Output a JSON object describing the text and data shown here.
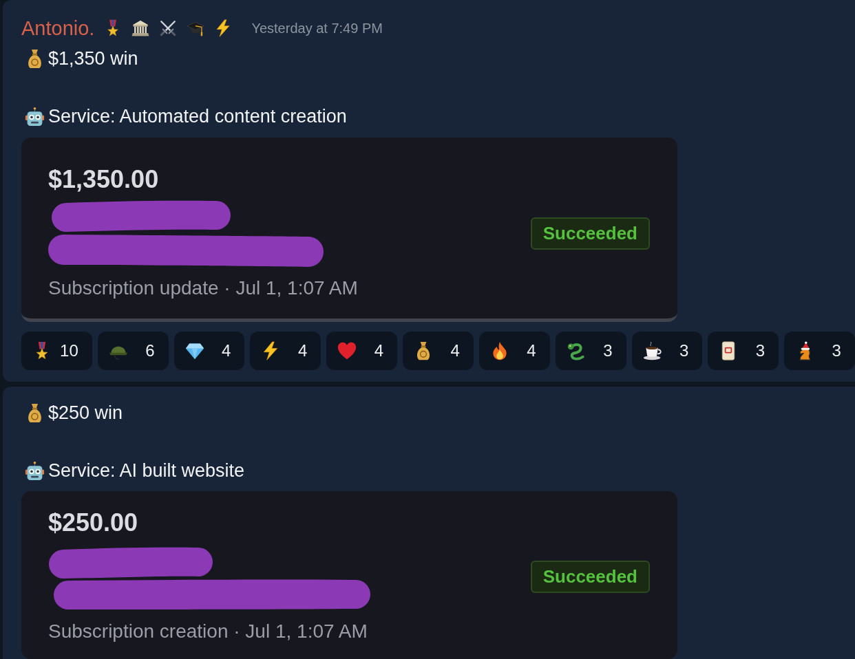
{
  "messages": [
    {
      "author": {
        "name": "Antonio.",
        "badges": [
          {
            "kind": "medal"
          },
          {
            "kind": "columns-building"
          },
          {
            "kind": "swords"
          },
          {
            "kind": "grad-cap"
          },
          {
            "kind": "bolt"
          }
        ]
      },
      "timestamp": "Yesterday at 7:49 PM",
      "lines": [
        {
          "kind": "money-bag",
          "text": "$1,350 win"
        },
        {
          "kind": "robot",
          "text": "Service: Automated content creation"
        }
      ],
      "attachment": {
        "amount": "$1,350.00",
        "status": "Succeeded",
        "subtitle": "Subscription update · Jul 1, 1:07 AM"
      },
      "reactions": [
        {
          "kind": "medal",
          "count": "10"
        },
        {
          "kind": "helmet",
          "count": "6"
        },
        {
          "kind": "gem",
          "count": "4"
        },
        {
          "kind": "bolt",
          "count": "4"
        },
        {
          "kind": "heart",
          "count": "4"
        },
        {
          "kind": "money-bag",
          "count": "4"
        },
        {
          "kind": "fire",
          "count": "4"
        },
        {
          "kind": "dragon",
          "count": "3"
        },
        {
          "kind": "coffee",
          "count": "3"
        },
        {
          "kind": "mahjong",
          "count": "3"
        },
        {
          "kind": "knight",
          "count": "3"
        }
      ]
    },
    {
      "lines": [
        {
          "kind": "money-bag",
          "text": "$250 win"
        },
        {
          "kind": "robot",
          "text": "Service: AI built website"
        }
      ],
      "attachment": {
        "amount": "$250.00",
        "status": "Succeeded",
        "subtitle": "Subscription creation · Jul 1, 1:07 AM"
      }
    }
  ]
}
